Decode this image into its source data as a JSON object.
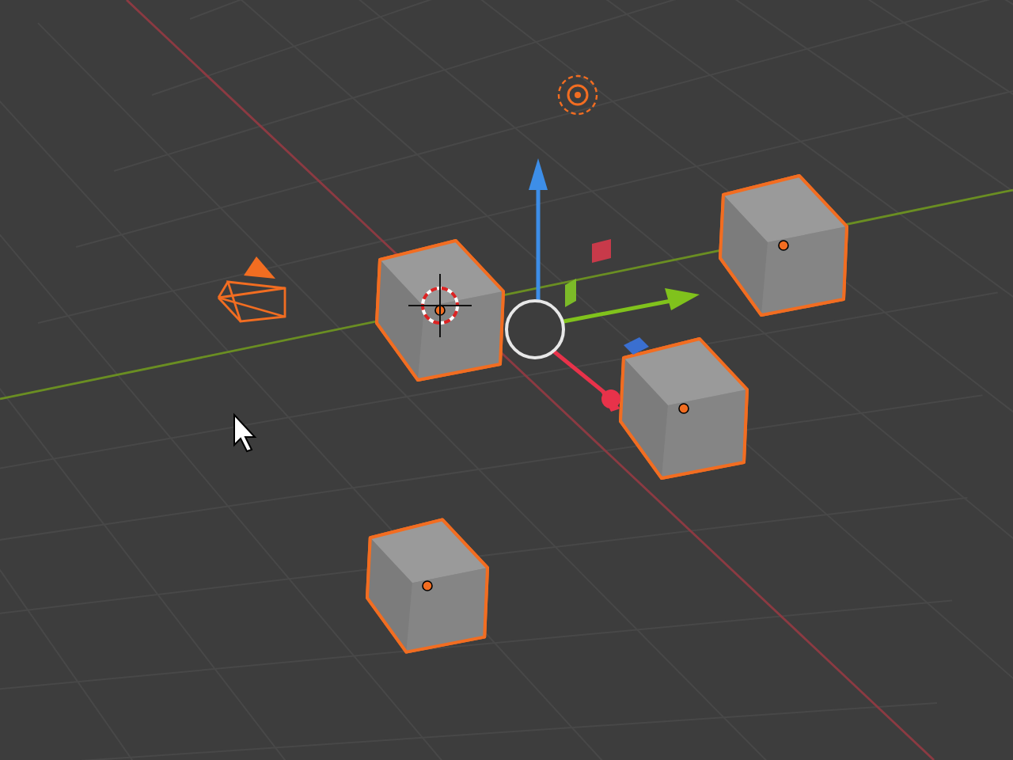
{
  "viewport": {
    "objects": [
      {
        "kind": "cube",
        "selected": true
      },
      {
        "kind": "cube",
        "selected": true
      },
      {
        "kind": "cube",
        "selected": true
      },
      {
        "kind": "cube",
        "selected": true
      },
      {
        "kind": "camera",
        "selected": true
      },
      {
        "kind": "light",
        "selected": true
      }
    ],
    "gizmo": {
      "kind": "move"
    }
  }
}
